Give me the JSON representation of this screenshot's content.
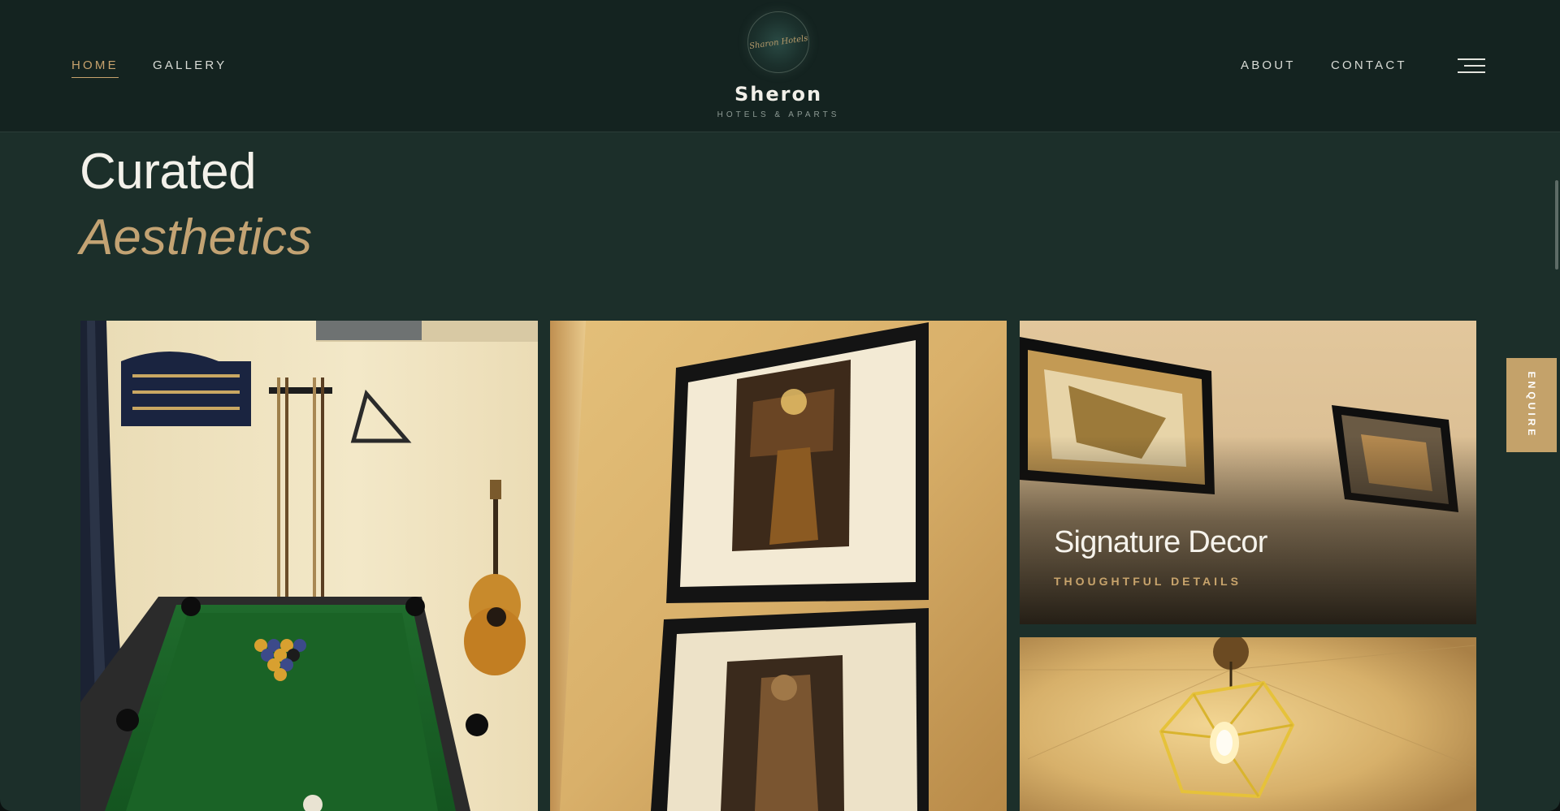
{
  "nav": {
    "left": [
      {
        "label": "HOME",
        "active": true
      },
      {
        "label": "GALLERY",
        "active": false
      }
    ],
    "right": [
      {
        "label": "ABOUT"
      },
      {
        "label": "CONTACT"
      }
    ],
    "menu_icon": "hamburger-icon"
  },
  "brand": {
    "logo_script": "Sharon Hotels",
    "name": "Sheron",
    "tagline": "HOTELS & APARTS"
  },
  "section": {
    "title_line1": "Curated",
    "title_line2": "Aesthetics"
  },
  "gallery": {
    "tiles": [
      {
        "image": "billiards-room-photo"
      },
      {
        "image": "framed-portraits-photo"
      },
      {
        "image": "framed-paintings-photo",
        "caption": "Signature Decor",
        "subcaption": "THOUGHTFUL DETAILS"
      },
      {
        "image": "pendant-lamp-photo"
      }
    ]
  },
  "side_tab": {
    "label": "ENQUIRE"
  },
  "colors": {
    "page_bg": "#1c2f2a",
    "header_bg": "#142320",
    "accent_gold": "#c4a26a",
    "text_light": "#f3f1ea"
  }
}
